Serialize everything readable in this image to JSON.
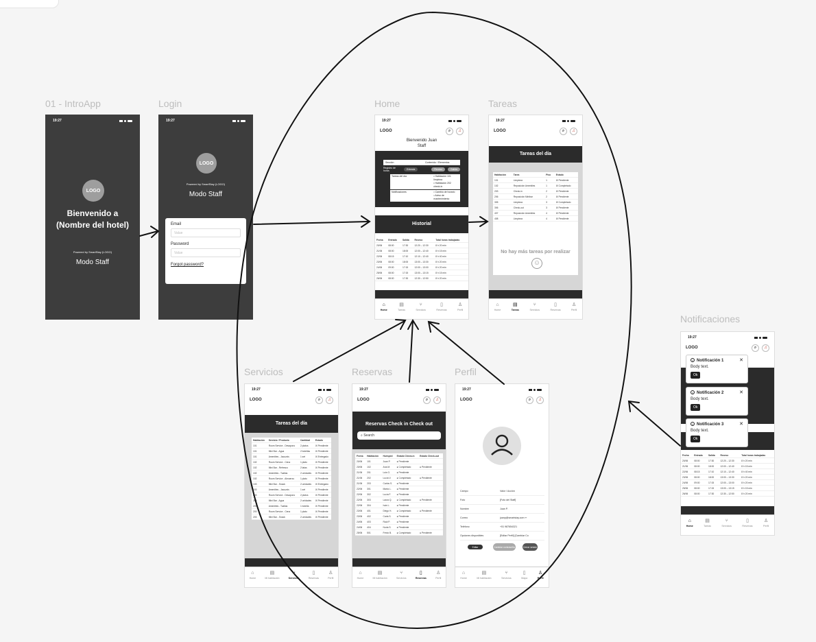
{
  "labels": {
    "intro": "01 - IntroApp",
    "login": "Login",
    "home": "Home",
    "tareas": "Tareas",
    "notificaciones": "Notificaciones",
    "servicios": "Servicios",
    "reservas": "Reservas",
    "perfil": "Perfil"
  },
  "status": {
    "time": "19:27"
  },
  "intro": {
    "logo": "LOGO",
    "welcome": "Bienvenido a",
    "hotel": "(Nombre del hotel)",
    "powered": "Powered by SmartStay (LOGO)",
    "mode": "Modo Staff"
  },
  "login": {
    "logo": "LOGO",
    "powered": "Powered by SmartStay (LOGO)",
    "mode": "Modo Staff",
    "email_label": "Email",
    "email_placeholder": "Value",
    "password_label": "Password",
    "password_placeholder": "Value",
    "forgot": "Forgot password?"
  },
  "header": {
    "logo": "LOGO"
  },
  "home": {
    "welcome": "Bienvenido Juan",
    "role": "Staff",
    "section_header": [
      "Sección",
      "Contenido / Elementos"
    ],
    "registro": "Registro de horas",
    "btn_entrada": "Entrada",
    "btn_receso": "Receso",
    "btn_salida": "Salida",
    "rows": [
      {
        "k": "Tareas del día",
        "v1": "• Habitación 101 limpieza",
        "v2": "• Habitación 202 check-in"
      },
      {
        "k": "Notificaciones",
        "v1": "• Cambio de horario",
        "v2": "• Aviso de mantenimiento"
      }
    ],
    "historial": "Historial",
    "hist_cols": [
      "Fecha",
      "Entrada",
      "Salida",
      "Receso",
      "Total horas trabajadas"
    ],
    "hist_rows": [
      [
        "20/06",
        "08:00",
        "17:30",
        "12:20 – 12:30",
        "8 h 20 min"
      ],
      [
        "21/06",
        "08:00",
        "18:00",
        "12:00 – 12:40",
        "8 h 15 min"
      ],
      [
        "22/06",
        "08:15",
        "17:10",
        "12:10 – 12:40",
        "8 h 40 min"
      ],
      [
        "23/06",
        "08:00",
        "18:00",
        "13:00 – 13:30",
        "8 h 20 min"
      ],
      [
        "24/06",
        "09:00",
        "17:15",
        "12:00 – 13:00",
        "8 h 20 min"
      ],
      [
        "25/06",
        "08:00",
        "17:15",
        "13:00 – 13:15",
        "8 h 15 min"
      ],
      [
        "26/06",
        "08:00",
        "17:30",
        "12:30 – 12:50",
        "8 h 20 min"
      ]
    ]
  },
  "nav": {
    "home": "Home",
    "tareas": "Tareas",
    "servicios": "Servicios",
    "reservas": "Reservas",
    "perfil": "Perfil",
    "mihab": "Mi habitación",
    "mapa": "Mapa"
  },
  "tareas": {
    "title": "Tareas del día",
    "cols": [
      "Habitación",
      "Tarea",
      "Piso",
      "Estado"
    ],
    "rows": [
      [
        "101",
        "Limpieza",
        "1",
        "Pendiente"
      ],
      [
        "102",
        "Reposición Amenities",
        "1",
        "Completado"
      ],
      [
        "203",
        "Check-in",
        "2",
        "Pendiente"
      ],
      [
        "206",
        "Reposición Minibar",
        "2",
        "Pendiente"
      ],
      [
        "305",
        "Limpieza",
        "3",
        "Completado"
      ],
      [
        "306",
        "Check-out",
        "3",
        "Pendiente"
      ],
      [
        "407",
        "Reposición Amenities",
        "4",
        "Pendiente"
      ],
      [
        "408",
        "Limpieza",
        "4",
        "Pendiente"
      ]
    ],
    "empty": "No hay más tareas por realizar"
  },
  "servicios": {
    "title": "Tareas del día",
    "cols": [
      "Habitación",
      "Servicio / Producto",
      "Cantidad",
      "Estado"
    ],
    "rows": [
      [
        "101",
        "Room Service - Desayuno",
        "2 platos",
        "Pendiente"
      ],
      [
        "101",
        "Mini Bar - Agua",
        "2 botellas",
        "Pendiente"
      ],
      [
        "101",
        "Amenities - Jacuzzis",
        "1 set",
        "Entregado"
      ],
      [
        "102",
        "Room Service - Cena",
        "1 plato",
        "Pendiente"
      ],
      [
        "102",
        "Mini Bar - Refresco",
        "2 latas",
        "Pendiente"
      ],
      [
        "102",
        "Amenities - Toallas",
        "2 unidades",
        "Pendiente"
      ],
      [
        "102",
        "Room Service - Almuerzo",
        "1 plato",
        "Pendiente"
      ],
      [
        "103",
        "Mini Bar - Snack",
        "2 unidades",
        "Entregado"
      ],
      [
        "103",
        "Amenities - Jacuzzis",
        "1 set",
        "Pendiente"
      ],
      [
        "203",
        "Room Service - Desayuno",
        "2 platos",
        "Pendiente"
      ],
      [
        "203",
        "Mini Bar - Agua",
        "2 unidades",
        "Pendiente"
      ],
      [
        "203",
        "Amenities - Toallas",
        "1 botella",
        "Pendiente"
      ],
      [
        "203",
        "Room Service - Cena",
        "1 plato",
        "Pendiente"
      ],
      [
        "203",
        "Mini Bar - Snack",
        "2 unidades",
        "Pendiente"
      ]
    ]
  },
  "reservas": {
    "title": "Reservas Check in Check out",
    "search": "Search",
    "cols": [
      "Fecha",
      "Habitación",
      "Huésped",
      "Estado Check-in",
      "Estado Check-out"
    ],
    "rows": [
      [
        "20/06",
        "101",
        "Juan P.",
        "Pendiente",
        ""
      ],
      [
        "20/06",
        "102",
        "Ana M.",
        "Completado",
        "Pendiente"
      ],
      [
        "21/06",
        "201",
        "Luis G.",
        "Pendiente",
        ""
      ],
      [
        "21/06",
        "202",
        "Lucía V.",
        "Completado",
        "Pendiente"
      ],
      [
        "21/06",
        "203",
        "Carlos S.",
        "Pendiente",
        ""
      ],
      [
        "22/06",
        "301",
        "Marta L.",
        "Pendiente",
        ""
      ],
      [
        "22/06",
        "302",
        "Lucía F.",
        "Pendiente",
        ""
      ],
      [
        "22/06",
        "303",
        "Laura Q.",
        "Completado",
        "Pendiente"
      ],
      [
        "22/06",
        "304",
        "Iván L.",
        "Pendiente",
        ""
      ],
      [
        "23/06",
        "401",
        "Diego H.",
        "Completado",
        "Pendiente"
      ],
      [
        "23/06",
        "402",
        "Carla S.",
        "Pendiente",
        ""
      ],
      [
        "24/06",
        "403",
        "Raúl P.",
        "Pendiente",
        ""
      ],
      [
        "24/06",
        "404",
        "Nuria S.",
        "Pendiente",
        ""
      ],
      [
        "25/06",
        "501",
        "Fredo B.",
        "Completado",
        "Pendiente"
      ]
    ]
  },
  "perfil": {
    "cols": [
      "Campo",
      "Valor / Acción"
    ],
    "rows": [
      [
        "Foto",
        "[Foto del Staff]"
      ],
      [
        "Nombre",
        "Juan P."
      ],
      [
        "Correo",
        "juanp@smartstay.com ✏"
      ],
      [
        "Teléfono",
        "+51 987654321"
      ],
      [
        "Opciones disponibles",
        "[Editar Perfil] [Cambiar Co"
      ]
    ],
    "btn_editar": "Editar",
    "btn_cambiar": "Cambiar contraseña",
    "btn_cerrar": "Cerrar sesión"
  },
  "notificaciones": {
    "items": [
      {
        "title": "Notificación 1",
        "body": "Body text.",
        "ok": "Ok"
      },
      {
        "title": "Notificación 2",
        "body": "Body text.",
        "ok": "Ok"
      },
      {
        "title": "Notificación 3",
        "body": "Body text.",
        "ok": "Ok"
      }
    ],
    "hist_cols": [
      "Fecha",
      "Entrada",
      "Salida",
      "Receso",
      "Total horas trabajadas"
    ],
    "hist_rows": [
      [
        "20/06",
        "08:00",
        "17:30",
        "12:20 – 12:30",
        "8 h 20 min"
      ],
      [
        "21/06",
        "08:00",
        "18:00",
        "12:00 – 12:40",
        "8 h 15 min"
      ],
      [
        "22/06",
        "08:15",
        "17:10",
        "12:10 – 12:40",
        "8 h 40 min"
      ],
      [
        "23/06",
        "08:00",
        "18:00",
        "13:00 – 13:30",
        "8 h 20 min"
      ],
      [
        "24/06",
        "09:00",
        "17:15",
        "12:00 – 13:00",
        "8 h 20 min"
      ],
      [
        "25/06",
        "08:00",
        "17:15",
        "13:00 – 13:15",
        "8 h 15 min"
      ],
      [
        "26/06",
        "08:00",
        "17:30",
        "12:30 – 12:50",
        "8 h 20 min"
      ]
    ]
  }
}
